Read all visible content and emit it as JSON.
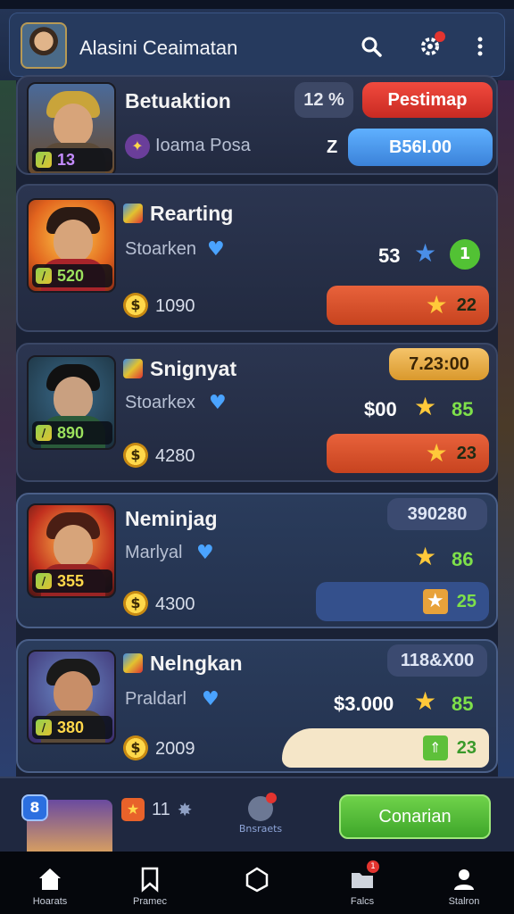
{
  "header": {
    "title": "Alasini Ceaimatan"
  },
  "cards": [
    {
      "name": "Betuaktion",
      "subtitle": "Ioama Posa",
      "level": "13",
      "percent": "12 %",
      "action_label": "Pestimap",
      "count": "Z",
      "price": "B56I.00"
    },
    {
      "name": "Rearting",
      "subtitle": "Stoarken",
      "level": "520",
      "coins": "1090",
      "stat": "53",
      "green_badge": "1",
      "bar_value": "22"
    },
    {
      "name": "Snignyat",
      "subtitle": "Stoarkex",
      "level": "890",
      "coins": "4280",
      "timer": "7.23:00",
      "price": "$00",
      "score": "85",
      "bar_value": "23"
    },
    {
      "name": "Neminjag",
      "subtitle": "Marlyal",
      "level": "355",
      "coins": "4300",
      "timer": "390280",
      "score": "86",
      "bar_value": "25"
    },
    {
      "name": "Nelngkan",
      "subtitle": "Praldarl",
      "level": "380",
      "coins": "2009",
      "timer": "118&X00",
      "price": "$3.000",
      "score": "85",
      "bar_value": "23"
    }
  ],
  "bottom_strip": {
    "badge": "8",
    "mini_value": "11",
    "browse_label": "Bnsraets",
    "cta_label": "Conarian"
  },
  "nav": [
    {
      "label": "Hoarats",
      "icon": "home-icon"
    },
    {
      "label": "Pramec",
      "icon": "bookmark-icon"
    },
    {
      "label": "",
      "icon": "hexagon-icon"
    },
    {
      "label": "Falcs",
      "icon": "folder-icon",
      "badge": "1"
    },
    {
      "label": "Stalron",
      "icon": "user-icon"
    }
  ]
}
